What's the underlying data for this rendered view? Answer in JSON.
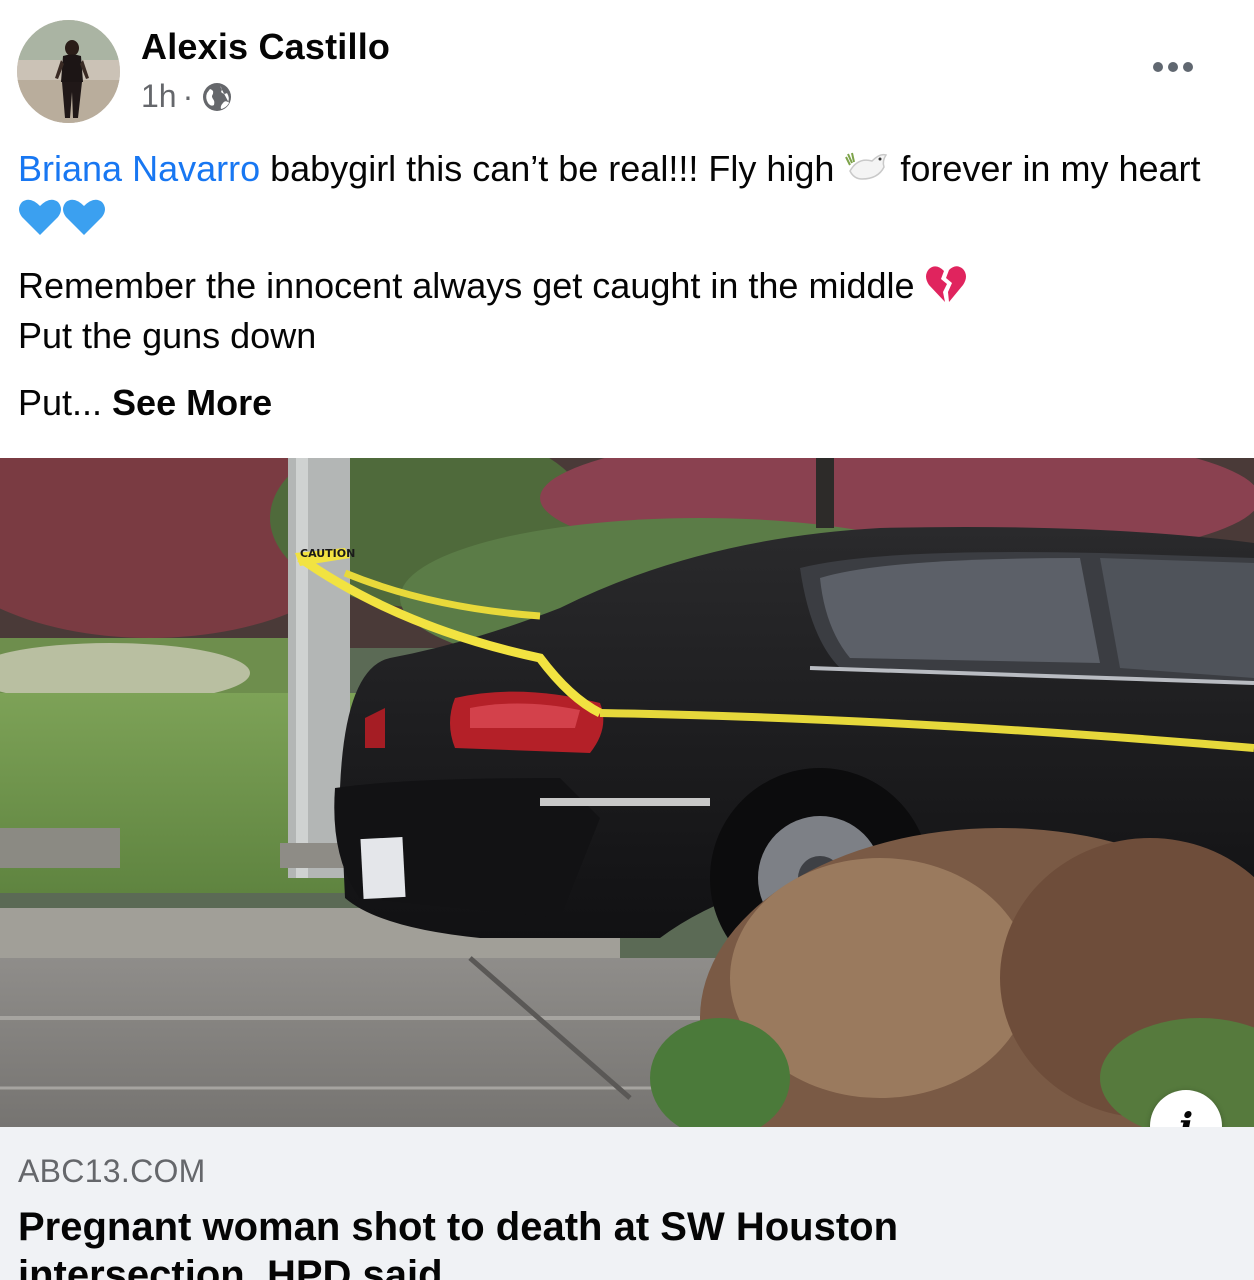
{
  "post": {
    "author": "Alexis Castillo",
    "time": "1h",
    "separator": "·",
    "privacy_icon": "globe-icon",
    "more_icon": "more-horizontal-icon"
  },
  "text": {
    "mention": "Briana Navarro",
    "line1_rest": " babygirl this can’t be real!!! Fly high ",
    "line1_after_dove": " forever in my heart ",
    "para2_line1": "Remember the innocent always get caught in the middle ",
    "para2_line2": "Put the guns down",
    "para3_prefix": "Put... ",
    "see_more": "See More"
  },
  "emojis": {
    "dove": "dove-emoji",
    "blue_heart": "blue-heart-emoji",
    "broken_heart": "broken-heart-emoji"
  },
  "link": {
    "domain": "ABC13.COM",
    "title": "Pregnant woman shot to death at SW Houston intersection, HPD said",
    "info_label": "i",
    "image_tape_text": "CAUTION"
  },
  "colors": {
    "mention": "#1877f2",
    "secondary_text": "#65676b",
    "footer_bg": "#f0f2f5",
    "blue_heart": "#3ba0f0",
    "broken_heart": "#e0245e",
    "tape": "#f2e341"
  }
}
